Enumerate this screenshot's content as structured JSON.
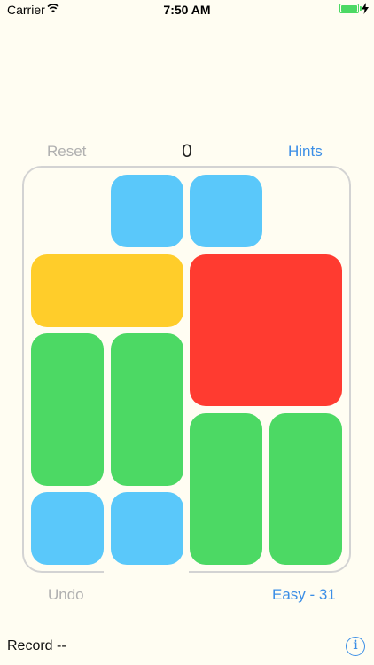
{
  "status_bar": {
    "carrier": "Carrier",
    "time": "7:50 AM",
    "wifi_icon": "wifi-icon",
    "battery_icon": "battery-full-charging-icon",
    "battery_level": 1.0
  },
  "controls": {
    "reset_label": "Reset",
    "move_count": "0",
    "hints_label": "Hints",
    "undo_label": "Undo",
    "level_label": "Easy - 31"
  },
  "footer": {
    "record_text": "Record --",
    "info_icon": "info-icon",
    "info_glyph": "i"
  },
  "colors": {
    "background": "#fffdf2",
    "blue_block": "#5ac8fa",
    "yellow_block": "#ffcd2a",
    "red_block": "#ff3b30",
    "green_block": "#4cd964",
    "accent": "#3b8ee6",
    "disabled_text": "#b0b0b0",
    "board_border": "#d3d3d3"
  },
  "board": {
    "columns": 4,
    "rows": 5,
    "exit_position": "bottom-center",
    "blocks": [
      {
        "name": "small-block-1",
        "color": "blue",
        "col": 1,
        "row": 0,
        "w": 1,
        "h": 1
      },
      {
        "name": "small-block-2",
        "color": "blue",
        "col": 2,
        "row": 0,
        "w": 1,
        "h": 1
      },
      {
        "name": "horizontal-block",
        "color": "yellow",
        "col": 0,
        "row": 1,
        "w": 2,
        "h": 1
      },
      {
        "name": "big-red-block",
        "color": "red",
        "col": 2,
        "row": 1,
        "w": 2,
        "h": 2
      },
      {
        "name": "vertical-block-1",
        "color": "green",
        "col": 0,
        "row": 2,
        "w": 1,
        "h": 2
      },
      {
        "name": "vertical-block-2",
        "color": "green",
        "col": 1,
        "row": 2,
        "w": 1,
        "h": 2
      },
      {
        "name": "vertical-block-3",
        "color": "green",
        "col": 2,
        "row": 3,
        "w": 1,
        "h": 2
      },
      {
        "name": "vertical-block-4",
        "color": "green",
        "col": 3,
        "row": 3,
        "w": 1,
        "h": 2
      },
      {
        "name": "small-block-3",
        "color": "blue",
        "col": 0,
        "row": 4,
        "w": 1,
        "h": 1
      },
      {
        "name": "small-block-4",
        "color": "blue",
        "col": 1,
        "row": 4,
        "w": 1,
        "h": 1
      }
    ]
  }
}
